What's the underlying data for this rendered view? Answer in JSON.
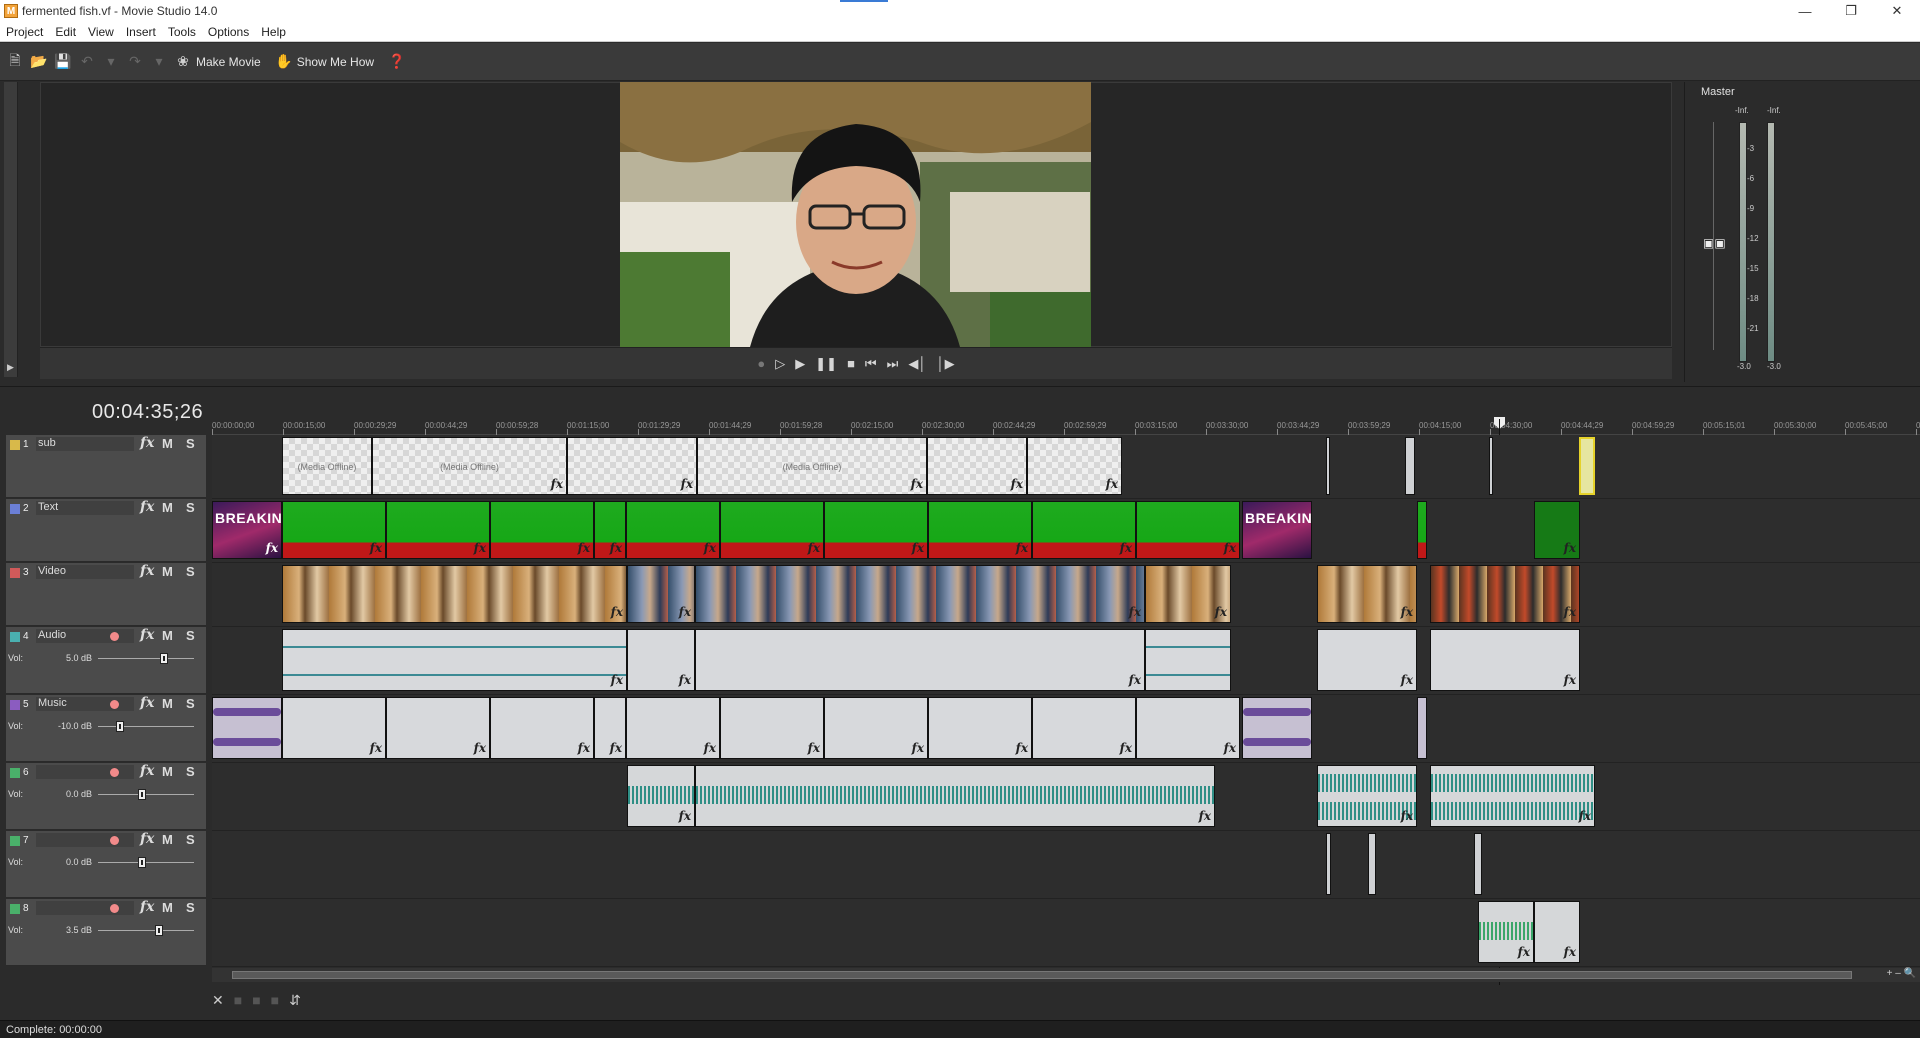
{
  "window": {
    "title": "fermented fish.vf - Movie Studio 14.0",
    "app_icon_letter": "M"
  },
  "menu": [
    "Project",
    "Edit",
    "View",
    "Insert",
    "Tools",
    "Options",
    "Help"
  ],
  "toolbar": {
    "make_movie": "Make Movie",
    "show_me_how": "Show Me How"
  },
  "master": {
    "title": "Master",
    "peak_left": "-Inf.",
    "peak_right": "-Inf.",
    "scale": [
      "3",
      "6",
      "9",
      "12",
      "15",
      "18",
      "21"
    ],
    "bottom_left": "-3.0",
    "bottom_right": "-3.0"
  },
  "timeline": {
    "current_time": "00:04:35;26",
    "ruler_labels": [
      "00:00:00;00",
      "00:00:15;00",
      "00:00:29;29",
      "00:00:44;29",
      "00:00:59;28",
      "00:01:15;00",
      "00:01:29;29",
      "00:01:44;29",
      "00:01:59;28",
      "00:02:15;00",
      "00:02:30;00",
      "00:02:44;29",
      "00:02:59;29",
      "00:03:15;00",
      "00:03:30;00",
      "00:03:44;29",
      "00:03:59;29",
      "00:04:15;00",
      "00:04:30;00",
      "00:04:44;29",
      "00:04:59;29",
      "00:05:15;01",
      "00:05:30;00",
      "00:05:45;00",
      "00:05:59;29"
    ]
  },
  "tracks": [
    {
      "num": "1",
      "name": "sub",
      "type": "video",
      "color": "#d8b94a"
    },
    {
      "num": "2",
      "name": "Text",
      "type": "video",
      "color": "#6b7fd6"
    },
    {
      "num": "3",
      "name": "Video",
      "type": "video",
      "color": "#d05a5a"
    },
    {
      "num": "4",
      "name": "Audio",
      "type": "audio",
      "color": "#4ab0b0",
      "vol_label": "Vol:",
      "vol": "5.0 dB",
      "knob": 0.7
    },
    {
      "num": "5",
      "name": "Music",
      "type": "audio",
      "color": "#8b5cc0",
      "vol_label": "Vol:",
      "vol": "-10.0 dB",
      "knob": 0.2
    },
    {
      "num": "6",
      "name": "",
      "type": "audio",
      "color": "#4ab06a",
      "vol_label": "Vol:",
      "vol": "0.0 dB",
      "knob": 0.45
    },
    {
      "num": "7",
      "name": "",
      "type": "audio",
      "color": "#4ab06a",
      "vol_label": "Vol:",
      "vol": "0.0 dB",
      "knob": 0.45
    },
    {
      "num": "8",
      "name": "",
      "type": "audio",
      "color": "#4ab06a",
      "vol_label": "Vol:",
      "vol": "3.5 dB",
      "knob": 0.65
    }
  ],
  "clips": {
    "sub_label": "(Media Offline)",
    "breaking_label": "BREAKIN"
  },
  "status": {
    "text": "Complete: 00:00:00"
  },
  "labels": {
    "fx": "fx",
    "mute": "M",
    "solo": "S"
  }
}
